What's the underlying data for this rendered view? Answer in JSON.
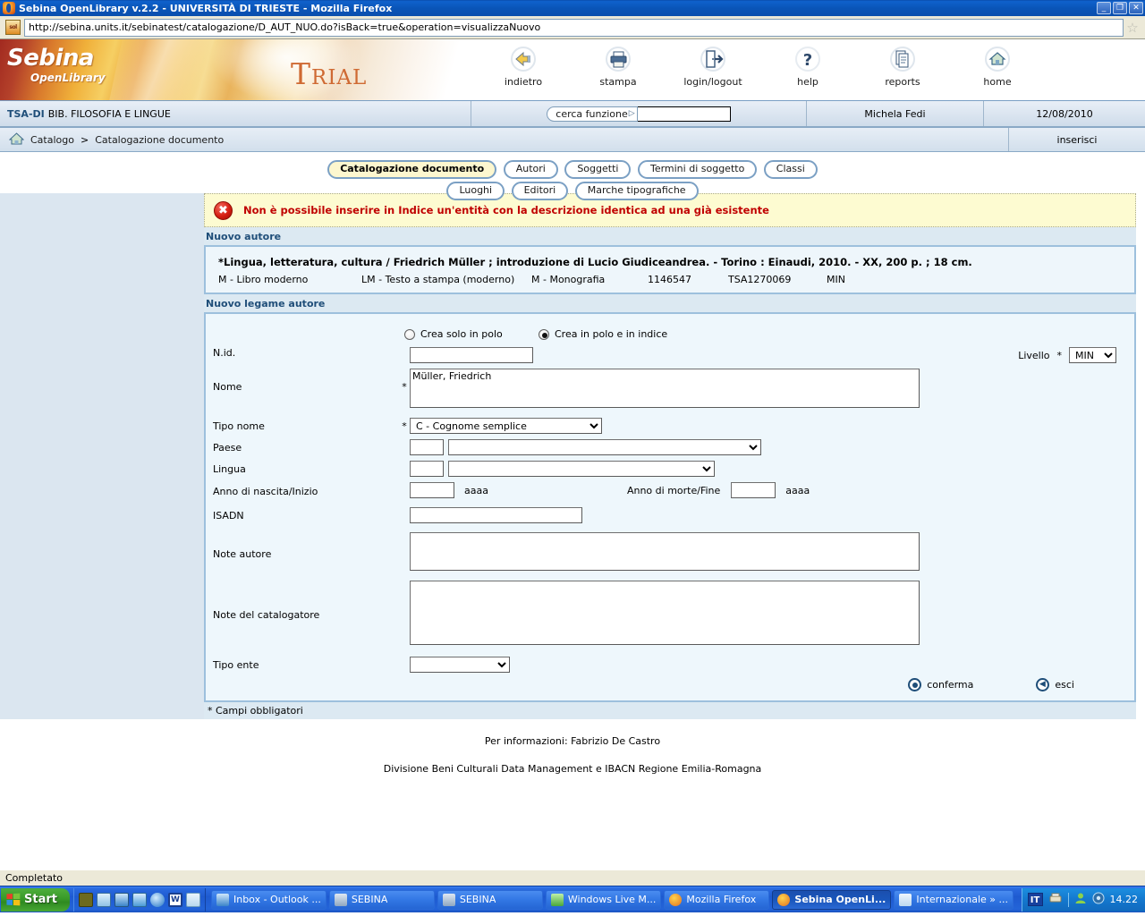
{
  "window": {
    "title": "Sebina OpenLibrary v.2.2 - UNIVERSITÀ DI TRIESTE - Mozilla Firefox",
    "minimize": "_",
    "restore": "❐",
    "close": "✕"
  },
  "browser": {
    "url": "http://sebina.units.it/sebinatest/catalogazione/D_AUT_NUO.do?isBack=true&operation=visualizzaNuovo",
    "favicon_text": "sol",
    "bookmark_star": "☆"
  },
  "logo": {
    "name": "Sebina",
    "subtitle": "OpenLibrary",
    "trial": "Trial"
  },
  "toolbar": {
    "items": [
      {
        "label": "indietro",
        "icon": "back-arrow-icon"
      },
      {
        "label": "stampa",
        "icon": "printer-icon"
      },
      {
        "label": "login/logout",
        "icon": "door-exit-icon"
      },
      {
        "label": "help",
        "icon": "question-mark-icon"
      },
      {
        "label": "reports",
        "icon": "documents-icon"
      },
      {
        "label": "home",
        "icon": "home-icon"
      }
    ]
  },
  "infobar": {
    "library_code": "TSA-DI",
    "library_name": "BIB. FILOSOFIA E LINGUE",
    "search_label": "cerca funzione",
    "search_value": "",
    "search_placeholder": "",
    "user": "Michela Fedi",
    "date": "12/08/2010"
  },
  "breadcrumb": {
    "home_icon": "home-icon",
    "items": [
      "Catalogo",
      "Catalogazione documento"
    ],
    "separator": ">",
    "action": "inserisci"
  },
  "tabs": {
    "row1": [
      {
        "label": "Catalogazione documento",
        "active": true
      },
      {
        "label": "Autori",
        "active": false
      },
      {
        "label": "Soggetti",
        "active": false
      },
      {
        "label": "Termini di soggetto",
        "active": false
      },
      {
        "label": "Classi",
        "active": false
      }
    ],
    "row2": [
      {
        "label": "Luoghi",
        "active": false
      },
      {
        "label": "Editori",
        "active": false
      },
      {
        "label": "Marche tipografiche",
        "active": false
      }
    ]
  },
  "error": {
    "icon": "error-x-icon",
    "glyph": "✖",
    "message": "Non è possibile inserire in Indice un'entità con la descrizione identica ad una già esistente",
    "color": "#c00000",
    "background": "#fdfbd1"
  },
  "section_nuovo_autore": "Nuovo autore",
  "record": {
    "title": "*Lingua, letteratura, cultura / Friedrich Müller ; introduzione di Lucio Giudiceandrea. - Torino : Einaudi, 2010. - XX, 200 p. ; 18 cm.",
    "meta": [
      "M - Libro moderno",
      "LM - Testo a stampa (moderno)",
      "M - Monografia",
      "1146547",
      "TSA1270069",
      "MIN"
    ]
  },
  "section_nuovo_legame": "Nuovo legame autore",
  "form": {
    "radios": [
      {
        "label": "Crea solo in polo",
        "selected": false
      },
      {
        "label": "Crea in polo e in indice",
        "selected": true
      }
    ],
    "nid": {
      "label": "N.id.",
      "value": "",
      "required": false
    },
    "livello": {
      "label": "Livello",
      "required": true,
      "value": "MIN",
      "options": [
        "MIN",
        "MED",
        "MAX"
      ]
    },
    "nome": {
      "label": "Nome",
      "required": true,
      "value": "Müller, Friedrich"
    },
    "tipo_nome": {
      "label": "Tipo nome",
      "required": true,
      "value": "C - Cognome semplice",
      "options": [
        "C - Cognome semplice",
        "A - Nome",
        "B - Cognome composto"
      ]
    },
    "paese": {
      "label": "Paese",
      "code": "",
      "value": "",
      "options": [
        ""
      ]
    },
    "lingua": {
      "label": "Lingua",
      "code": "",
      "value": "",
      "options": [
        ""
      ]
    },
    "anno_nascita": {
      "label": "Anno di nascita/Inizio",
      "value": "",
      "hint": "aaaa"
    },
    "anno_morte": {
      "label": "Anno di morte/Fine",
      "value": "",
      "hint": "aaaa"
    },
    "isadn": {
      "label": "ISADN",
      "value": ""
    },
    "note_autore": {
      "label": "Note autore",
      "value": ""
    },
    "note_catalogatore": {
      "label": "Note del catalogatore",
      "value": ""
    },
    "tipo_ente": {
      "label": "Tipo ente",
      "value": "",
      "options": [
        ""
      ]
    },
    "actions": {
      "confirm": "conferma",
      "exit": "esci"
    },
    "mandatory_note": "* Campi obbligatori"
  },
  "footer": {
    "info_label": "Per informazioni:",
    "info_name": "Fabrizio De Castro",
    "credits": "Divisione Beni Culturali Data Management  e  IBACN Regione Emilia-Romagna"
  },
  "statusbar": {
    "text": "Completato"
  },
  "taskbar": {
    "start": "Start",
    "quicklaunch": [
      {
        "name": "clock-icon"
      },
      {
        "name": "notes-icon"
      },
      {
        "name": "outlook-icon"
      },
      {
        "name": "msn-icon"
      },
      {
        "name": "internet-explorer-icon"
      },
      {
        "name": "word-icon"
      },
      {
        "name": "editor-icon"
      }
    ],
    "tasks": [
      {
        "label": "Inbox - Outlook ...",
        "active": false,
        "icon": "outlook-icon"
      },
      {
        "label": "SEBINA",
        "active": false,
        "icon": "network-icon"
      },
      {
        "label": "SEBINA",
        "active": false,
        "icon": "network-icon"
      },
      {
        "label": "Windows Live M...",
        "active": false,
        "icon": "messenger-icon"
      },
      {
        "label": "Mozilla Firefox",
        "active": false,
        "icon": "firefox-icon"
      },
      {
        "label": "Sebina OpenLi...",
        "active": true,
        "icon": "firefox-icon"
      },
      {
        "label": "Internazionale » ...",
        "active": false,
        "icon": "ie-doc-icon"
      }
    ],
    "tray": {
      "language": "IT",
      "time": "14.22"
    }
  }
}
